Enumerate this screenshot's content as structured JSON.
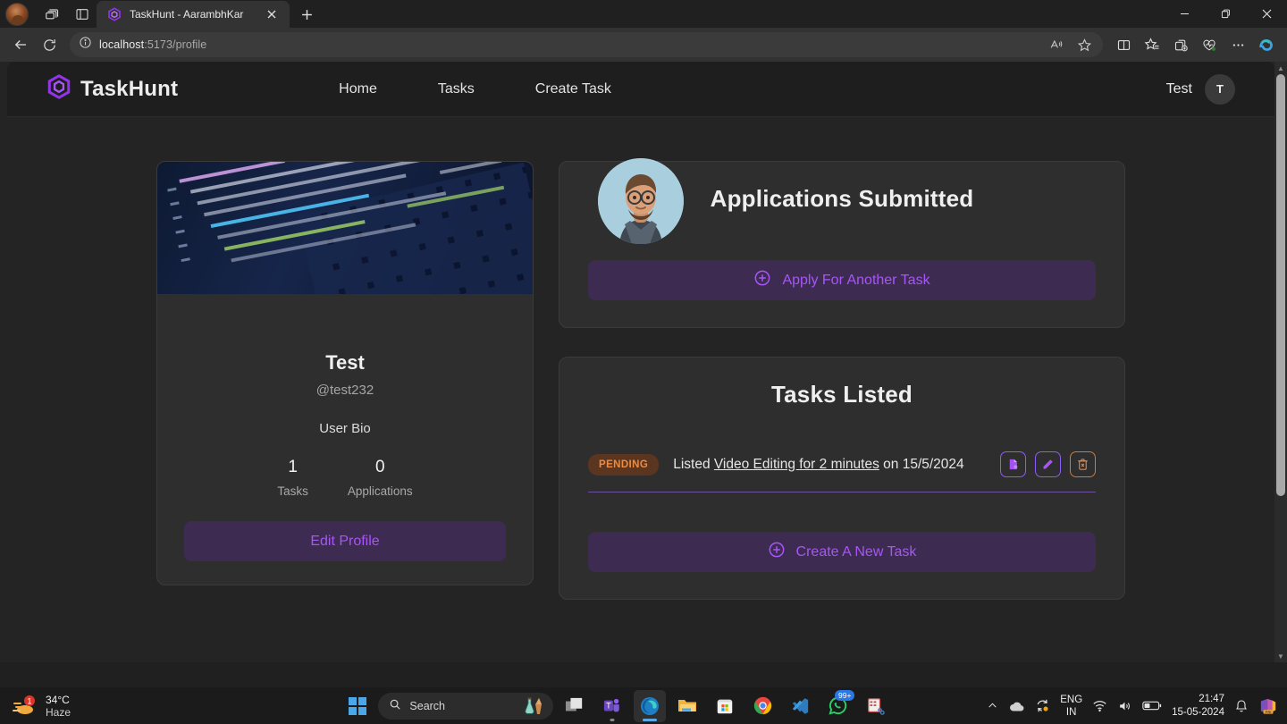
{
  "browser": {
    "tab": {
      "title": "TaskHunt - AarambhKar",
      "favicon": "taskhunt-hexagon-icon"
    },
    "new_tab_label": "+",
    "window_controls": {
      "minimize": "—",
      "maximize": "❐",
      "close": "✕"
    },
    "address": {
      "host": "localhost",
      "rest": ":5173/profile",
      "full": "localhost:5173/profile"
    },
    "toolbar_icons": [
      "back-arrow-icon",
      "refresh-icon",
      "info-circle-icon",
      "read-aloud-icon",
      "favorite-star-icon",
      "split-screen-icon",
      "favorites-icon",
      "collections-icon",
      "browser-essentials-icon",
      "more-options-icon",
      "copilot-icon"
    ]
  },
  "app": {
    "brand": "TaskHunt",
    "nav": [
      {
        "label": "Home"
      },
      {
        "label": "Tasks"
      },
      {
        "label": "Create Task"
      }
    ],
    "user": {
      "name": "Test",
      "initial": "T"
    }
  },
  "profile": {
    "name": "Test",
    "handle": "@test232",
    "bio": "User Bio",
    "stats": [
      {
        "value": "1",
        "label": "Tasks"
      },
      {
        "value": "0",
        "label": "Applications"
      }
    ],
    "edit_button": "Edit Profile"
  },
  "applications_panel": {
    "title": "Applications Submitted",
    "apply_button": "Apply For Another Task"
  },
  "tasks_panel": {
    "title": "Tasks Listed",
    "create_button": "Create A New Task",
    "tasks": [
      {
        "status": "PENDING",
        "prefix": "Listed ",
        "title": "Video Editing for 2 minutes",
        "middle": " on ",
        "date": "15/5/2024",
        "actions": [
          "view-applicants-icon",
          "edit-task-icon",
          "delete-task-icon"
        ]
      }
    ]
  },
  "colors": {
    "accent": "#a855f7",
    "accent_bg": "#3d2b52",
    "badge_bg": "#5a3520",
    "badge_text": "#f08a3c",
    "card_bg": "#2e2e2e",
    "page_bg": "#242424",
    "header_bg": "#1e1e1e",
    "divider": "#6d4f9c",
    "danger": "#c57a47"
  },
  "taskbar": {
    "weather": {
      "temp": "34°C",
      "condition": "Haze",
      "badge": "1"
    },
    "search_placeholder": "Search",
    "apps": [
      "start-icon",
      "task-view-icon",
      "teams-icon",
      "edge-icon",
      "file-explorer-icon",
      "microsoft-store-icon",
      "chrome-icon",
      "vscode-icon",
      "whatsapp-icon",
      "snipping-tool-icon"
    ],
    "whatsapp_badge": "99+",
    "tray": {
      "language": "ENG",
      "region": "IN",
      "time": "21:47",
      "date": "15-05-2024",
      "icons": [
        "show-hidden-icons-chevron",
        "onedrive-icon",
        "windows-update-icon",
        "wifi-icon",
        "volume-icon",
        "battery-icon",
        "notification-bell-icon",
        "office-icon"
      ]
    }
  }
}
